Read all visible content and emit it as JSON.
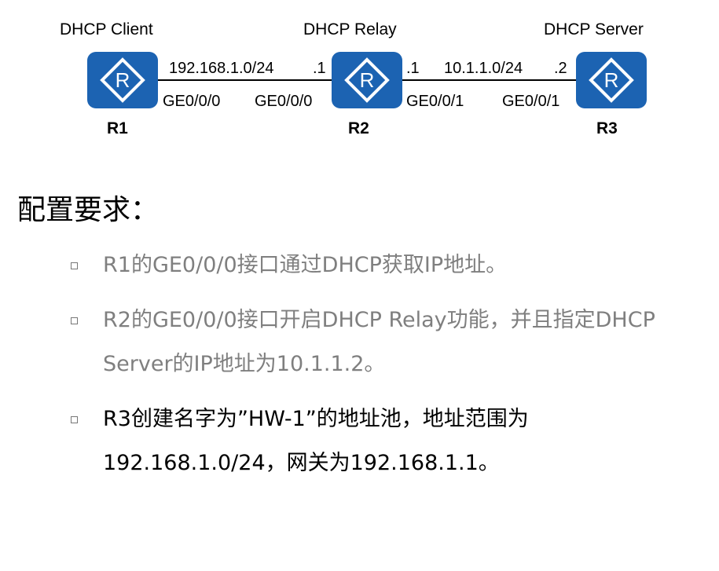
{
  "topology": {
    "roles": [
      "DHCP Client",
      "DHCP Relay",
      "DHCP Server"
    ],
    "routers": [
      "R1",
      "R2",
      "R3"
    ],
    "links": [
      {
        "network": "192.168.1.0/24",
        "left_host": "",
        "right_host": ".1",
        "left_iface": "GE0/0/0",
        "right_iface": "GE0/0/0"
      },
      {
        "network": "10.1.1.0/24",
        "left_host": ".1",
        "right_host": ".2",
        "left_iface": "GE0/0/1",
        "right_iface": "GE0/0/1"
      }
    ],
    "router_icon": "router-r-icon",
    "router_color": "#1c63b2"
  },
  "requirements": {
    "heading": "配置要求：",
    "items": [
      {
        "text": "R1的GE0/0/0接口通过DHCP获取IP地址。",
        "color": "#7f7f7f"
      },
      {
        "text": "R2的GE0/0/0接口开启DHCP Relay功能，并且指定DHCP Server的IP地址为10.1.1.2。",
        "color": "#7f7f7f"
      },
      {
        "text": "R3创建名字为”HW-1”的地址池，地址范围为192.168.1.0/24，网关为192.168.1.1。",
        "color": "#000000"
      }
    ]
  }
}
